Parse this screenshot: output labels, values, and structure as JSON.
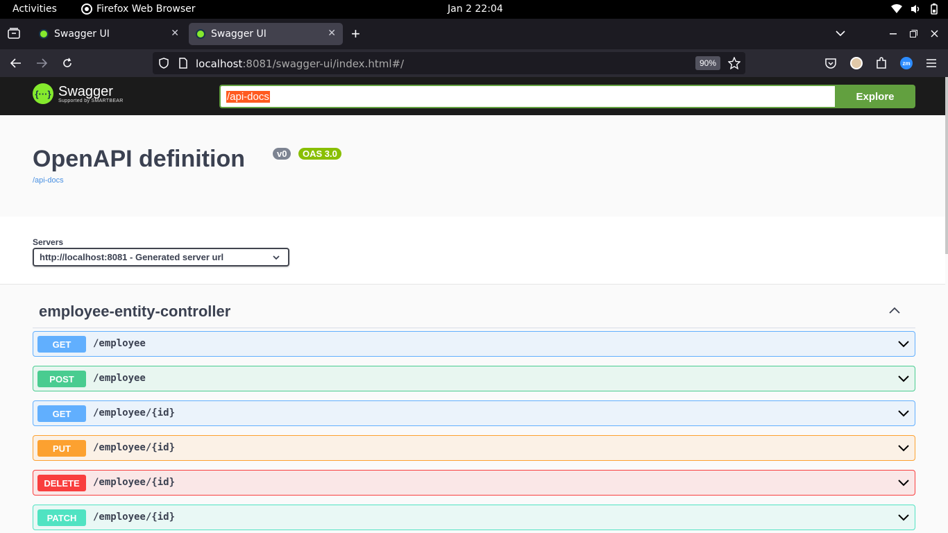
{
  "system_bar": {
    "activities": "Activities",
    "app_name": "Firefox Web Browser",
    "clock": "Jan 2  22:04"
  },
  "browser": {
    "tabs": [
      {
        "title": "Swagger UI",
        "active": false
      },
      {
        "title": "Swagger UI",
        "active": true
      }
    ],
    "url_host": "localhost",
    "url_rest": ":8081/swagger-ui/index.html#/",
    "zoom": "90%"
  },
  "swagger_header": {
    "logo_text": "Swagger",
    "logo_sub": "Supported by SMARTBEAR",
    "api_url": "/api-docs",
    "explore_label": "Explore"
  },
  "info": {
    "title": "OpenAPI definition",
    "version_badge": "v0",
    "oas_badge": "OAS 3.0",
    "spec_link": "/api-docs"
  },
  "servers": {
    "label": "Servers",
    "selected": "http://localhost:8081 - Generated server url"
  },
  "section": {
    "title": "employee-entity-controller",
    "operations": [
      {
        "method": "GET",
        "path": "/employee",
        "color": "#61affe",
        "bg": "#ebf3fb"
      },
      {
        "method": "POST",
        "path": "/employee",
        "color": "#49cc90",
        "bg": "#e8f6f0"
      },
      {
        "method": "GET",
        "path": "/employee/{id}",
        "color": "#61affe",
        "bg": "#ebf3fb"
      },
      {
        "method": "PUT",
        "path": "/employee/{id}",
        "color": "#fca130",
        "bg": "#fbf1e6"
      },
      {
        "method": "DELETE",
        "path": "/employee/{id}",
        "color": "#f93e3e",
        "bg": "#fae7e7"
      },
      {
        "method": "PATCH",
        "path": "/employee/{id}",
        "color": "#50e3c2",
        "bg": "#e9f8f5"
      }
    ]
  },
  "colors": {
    "swagger_green": "#85ea2d",
    "explore_green": "#62a03f",
    "version_badge": "#7d8492",
    "oas_badge": "#89bf04"
  }
}
